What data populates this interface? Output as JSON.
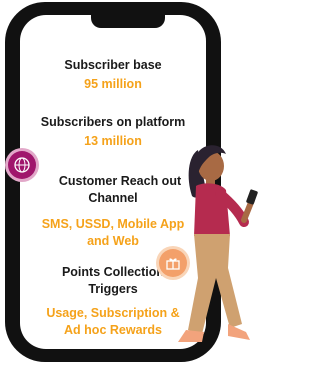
{
  "stats": [
    {
      "title": "Subscriber base",
      "value": "95 million"
    },
    {
      "title": "Subscribers on platform",
      "value": "13 million"
    },
    {
      "title_line1": "Customer Reach out",
      "title_line2": "Channel",
      "value_line1": "SMS, USSD, Mobile App",
      "value_line2": "and Web"
    },
    {
      "title_line1": "Points Collection",
      "title_line2": "Triggers",
      "value_line1": "Usage, Subscription &",
      "value_line2": "Ad hoc Rewards"
    }
  ],
  "colors": {
    "accent": "#f5a21a",
    "phone": "#111111",
    "badge1": "#a0166c",
    "badge2": "#f3a06a"
  },
  "icons": {
    "badge1": "globe-share-icon",
    "badge2": "gift-icon"
  },
  "illustration": "woman-using-phone"
}
